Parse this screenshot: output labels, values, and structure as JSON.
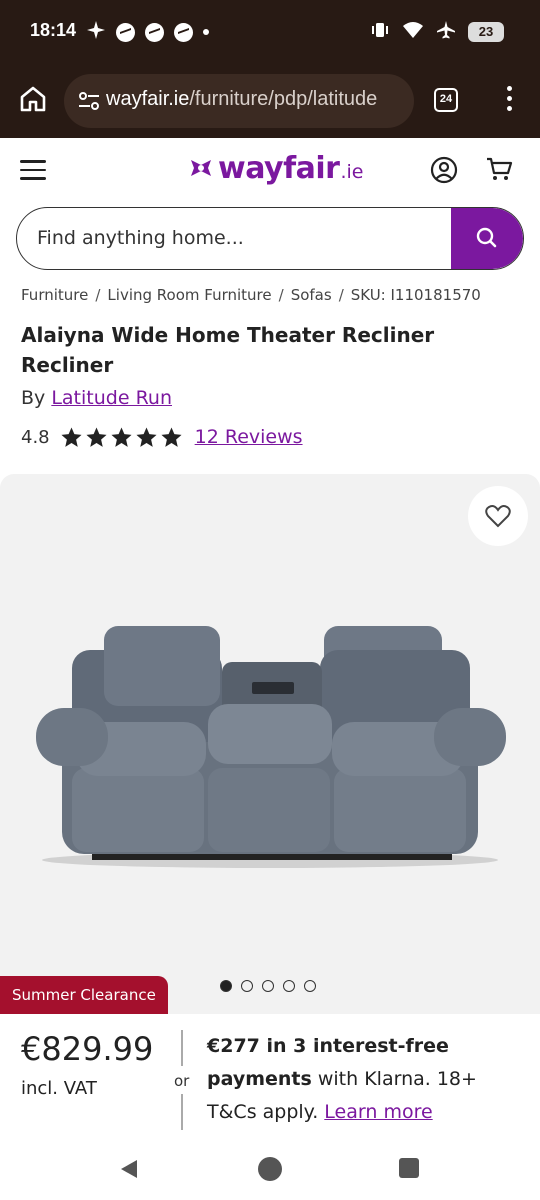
{
  "status_bar": {
    "time": "18:14",
    "battery": "23"
  },
  "browser": {
    "url_host": "wayfair.ie",
    "url_path": "/furniture/pdp/latitude",
    "tab_count": "24"
  },
  "site": {
    "logo_word": "wayfair",
    "logo_tld": ".ie",
    "brand_color": "#7b189f"
  },
  "search": {
    "placeholder": "Find anything home..."
  },
  "breadcrumb": {
    "items": [
      "Furniture",
      "Living Room Furniture",
      "Sofas"
    ],
    "sku": "SKU: I110181570"
  },
  "product": {
    "title": "Alaiyna Wide Home Theater Recliner Recliner",
    "by_prefix": "By",
    "brand": "Latitude Run",
    "rating": "4.8",
    "rating_stars": 5,
    "reviews": "12 Reviews"
  },
  "gallery": {
    "image_count": 5,
    "active_index": 0
  },
  "badge": "Summer Clearance",
  "pricing": {
    "price": "€829.99",
    "vat": "incl. VAT",
    "or": "or",
    "klarna_bold_1": "€277 in 3 interest-free",
    "klarna_bold_2": "payments",
    "klarna_text_1": " with Klarna. 18+",
    "klarna_text_2": "T&Cs apply. ",
    "learn_more": "Learn more"
  }
}
